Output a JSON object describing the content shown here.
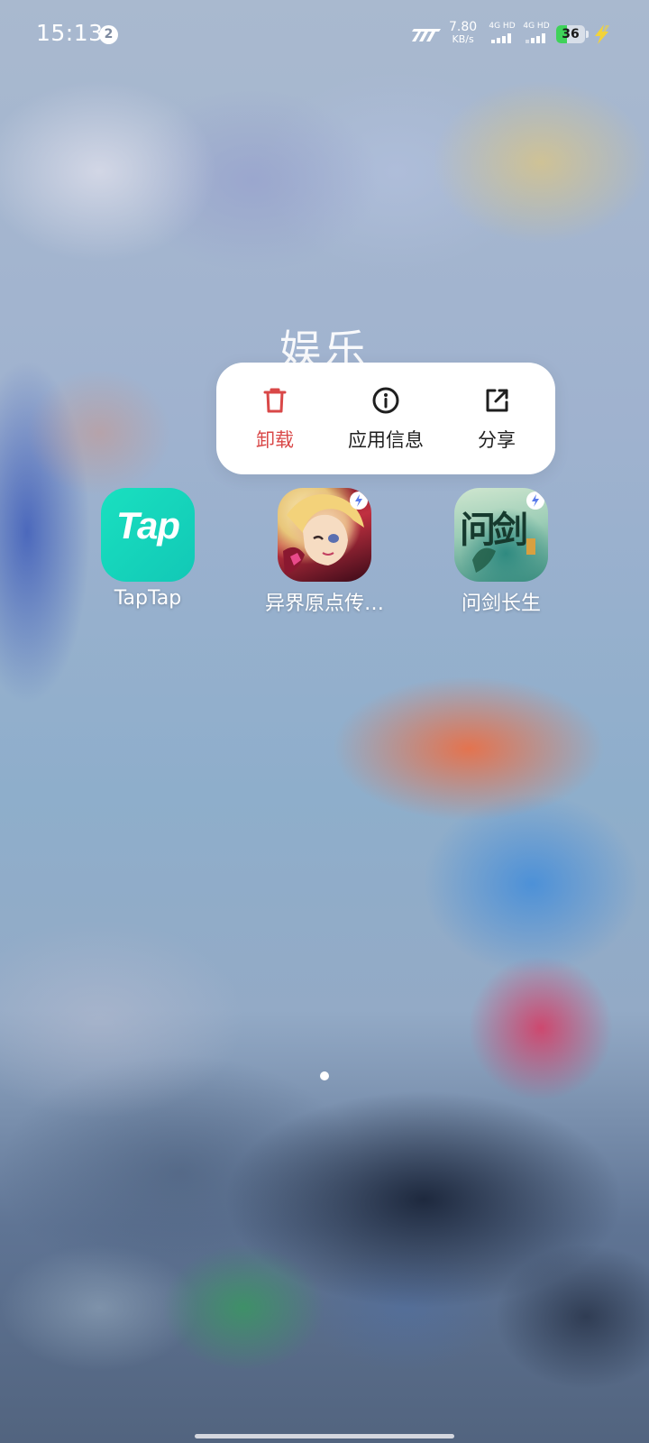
{
  "status_bar": {
    "time": "15:13",
    "notification_count": "2",
    "net_speed_value": "7.80",
    "net_speed_unit": "KB/s",
    "sim1_label": "4G HD",
    "sim2_label": "4G HD",
    "battery_level": "36",
    "battery_percent": 36,
    "battery_color": "#3fd25a"
  },
  "folder": {
    "title": "娱乐"
  },
  "context_menu": {
    "items": [
      {
        "label": "卸载",
        "icon": "trash-icon",
        "color": "#d94848"
      },
      {
        "label": "应用信息",
        "icon": "info-icon"
      },
      {
        "label": "分享",
        "icon": "share-icon"
      }
    ]
  },
  "apps": [
    {
      "name": "TapTap",
      "icon_text": "Tap",
      "color": "#14d4bb"
    },
    {
      "name": "异界原点传…",
      "icon": "anime-character-game-icon"
    },
    {
      "name": "问剑长生",
      "icon_text": "问剑"
    }
  ],
  "page_indicator": {
    "current": 1,
    "total": 1
  }
}
